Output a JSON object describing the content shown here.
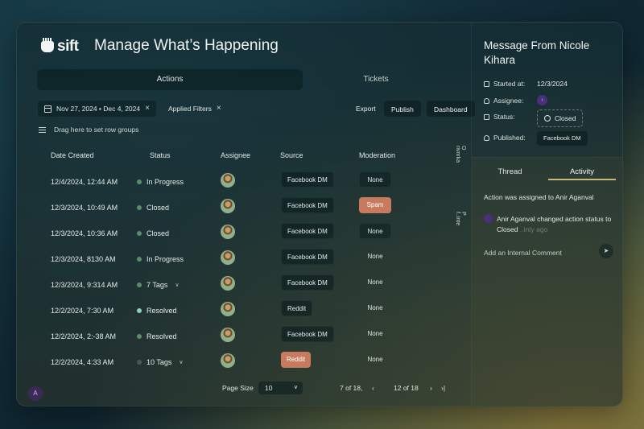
{
  "app": {
    "logo": "sift",
    "title": "Manage What’s Happening"
  },
  "tabs": [
    "Actions",
    "Tickets"
  ],
  "filters": {
    "date_range": "Nov 27, 2024 • Dec 4, 2024",
    "applied": "Applied Filters"
  },
  "toolbar": {
    "export": "Export",
    "publish": "Publish",
    "dashboard": "Dashboard"
  },
  "row_groups": "Drag here to set row groups",
  "columns": {
    "date": "Date Created",
    "status": "Status",
    "assignee": "Assignee",
    "source": "Source",
    "moderation": "Moderation"
  },
  "rows": [
    {
      "date": "12/4/2024, 12:44 AM",
      "status": "In Progress",
      "source": "Facebook DM",
      "moderation": "None"
    },
    {
      "date": "12/3/2024, 10:49 AM",
      "status": "Closed",
      "source": "Facebook DM",
      "moderation": "Spam"
    },
    {
      "date": "12/3/2024, 10:36 AM",
      "status": "Closed",
      "source": "Facebook DM",
      "moderation": "None"
    },
    {
      "date": "12/3/2024, 8130 AM",
      "status": "In Progress",
      "source": "Facebook DM",
      "moderation": "None"
    },
    {
      "date": "12/3/2024, 9:314 AM",
      "status": "7 Tags",
      "source": "Facebook DM",
      "moderation": "None"
    },
    {
      "date": "12/2/2024, 7:30 AM",
      "status": "Resolved",
      "source": "Reddit",
      "moderation": "None"
    },
    {
      "date": "12/2/2024, 2:-38 AM",
      "status": "Resolved",
      "source": "Facebook DM",
      "moderation": "None"
    },
    {
      "date": "12/2/2024, 4:33 AM",
      "status": "10 Tags",
      "source": "Reddit",
      "moderation": "None"
    }
  ],
  "side_tabs": [
    "O rivnrka",
    "P f..inte"
  ],
  "pager": {
    "label": "Page Size",
    "size": "10",
    "range": "7 of 18,",
    "page": "12 of 18"
  },
  "user_badge": "A",
  "panel": {
    "title": "Message From Nicole Kihara",
    "started_label": "Started at:",
    "started_value": "12/3/2024",
    "assignee_label": "Assignee:",
    "status_label": "Status:",
    "status_value": "Closed",
    "published_label": "Published:",
    "published_value": "Facebook DM",
    "tab_thread": "Thread",
    "tab_activity": "Activity",
    "activity_1": "Action was assigned to Anir Aganval",
    "activity_2": "Anir Aganval changed action status to Closed",
    "activity_2_time": "..inty ago",
    "comment_placeholder": "Add an Internal Comment"
  }
}
